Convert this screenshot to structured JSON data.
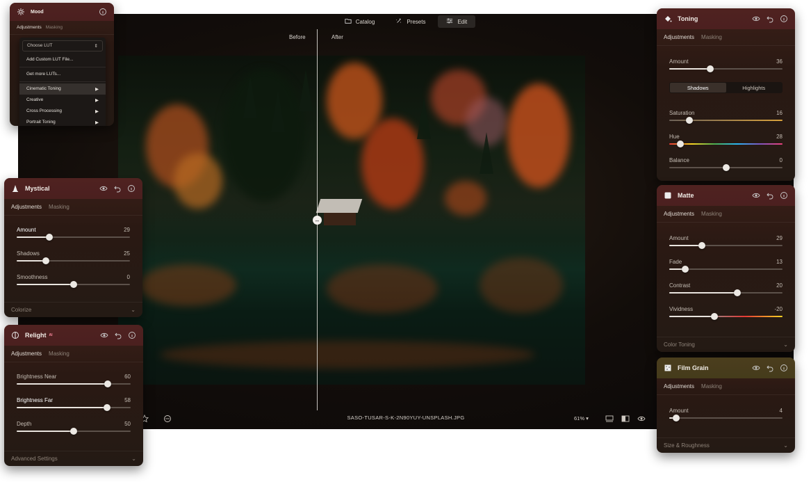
{
  "app": {
    "nav": [
      {
        "label": "Catalog",
        "icon": "folder-icon"
      },
      {
        "label": "Presets",
        "icon": "sparkle-icon"
      },
      {
        "label": "Edit",
        "icon": "sliders-icon",
        "active": true
      }
    ],
    "before_label": "Before",
    "after_label": "After",
    "filename": "SASO-TUSAR-S-K-2N90YUY-UNSPLASH.JPG",
    "zoom": "61%"
  },
  "mood": {
    "title": "Mood",
    "tabs": [
      "Adjustments",
      "Masking"
    ],
    "select_placeholder": "Choose LUT",
    "items": [
      {
        "label": "Add Custom LUT File...",
        "submenu": false
      },
      {
        "label": "Get more LUTs...",
        "submenu": false
      },
      {
        "label": "Cinematic Toning",
        "submenu": true
      },
      {
        "label": "Creative",
        "submenu": true
      },
      {
        "label": "Cross Processing",
        "submenu": true
      },
      {
        "label": "Portrait Toning",
        "submenu": true
      }
    ]
  },
  "mystical": {
    "title": "Mystical",
    "tabs": [
      "Adjustments",
      "Masking"
    ],
    "sliders": [
      {
        "label": "Amount",
        "value": "29",
        "pos": 0.29,
        "bold": true
      },
      {
        "label": "Shadows",
        "value": "25",
        "pos": 0.26,
        "bold": false
      },
      {
        "label": "Smoothness",
        "value": "0",
        "pos": 0.5,
        "bold": false
      }
    ],
    "footer": "Colorize"
  },
  "relight": {
    "title": "Relight",
    "ai_tag": "AI",
    "tabs": [
      "Adjustments",
      "Masking"
    ],
    "sliders": [
      {
        "label": "Brightness Near",
        "value": "60",
        "pos": 0.8,
        "bold": false
      },
      {
        "label": "Brightness Far",
        "value": "58",
        "pos": 0.79,
        "bold": true
      },
      {
        "label": "Depth",
        "value": "50",
        "pos": 0.5,
        "bold": false
      }
    ],
    "footer": "Advanced Settings"
  },
  "toning": {
    "title": "Toning",
    "tabs": [
      "Adjustments",
      "Masking"
    ],
    "amount": {
      "label": "Amount",
      "value": "36",
      "pos": 0.36
    },
    "segments": [
      "Shadows",
      "Highlights"
    ],
    "sliders": [
      {
        "label": "Saturation",
        "value": "16",
        "pos": 0.18
      },
      {
        "label": "Hue",
        "value": "28",
        "pos": 0.1
      },
      {
        "label": "Balance",
        "value": "0",
        "pos": 0.5
      }
    ]
  },
  "matte": {
    "title": "Matte",
    "tabs": [
      "Adjustments",
      "Masking"
    ],
    "sliders": [
      {
        "label": "Amount",
        "value": "29",
        "pos": 0.29
      },
      {
        "label": "Fade",
        "value": "13",
        "pos": 0.14
      },
      {
        "label": "Contrast",
        "value": "20",
        "pos": 0.6
      },
      {
        "label": "Vividness",
        "value": "-20",
        "pos": 0.4
      }
    ],
    "footer": "Color Toning"
  },
  "filmgrain": {
    "title": "Film Grain",
    "tabs": [
      "Adjustments",
      "Masking"
    ],
    "sliders": [
      {
        "label": "Amount",
        "value": "4",
        "pos": 0.06
      }
    ],
    "footer": "Size & Roughness"
  }
}
